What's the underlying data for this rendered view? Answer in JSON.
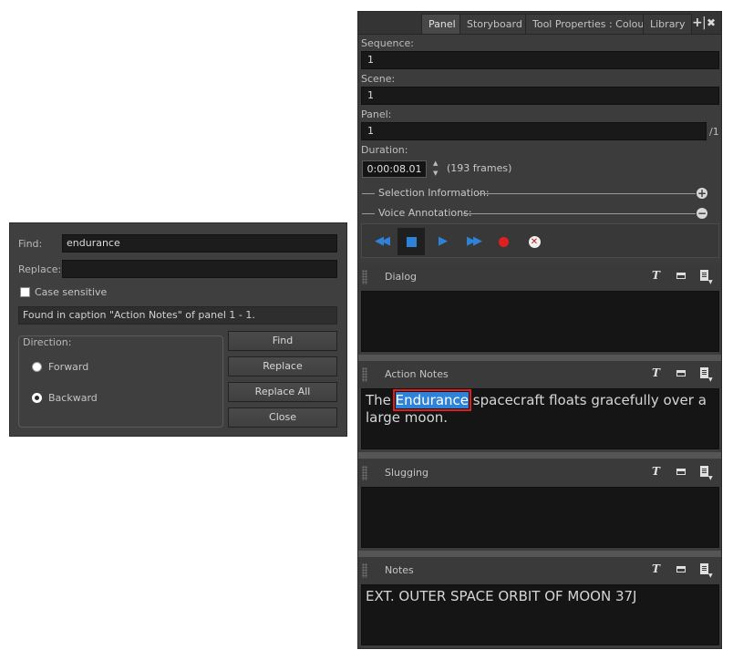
{
  "find_dialog": {
    "find_label": "Find:",
    "find_value": "endurance",
    "replace_label": "Replace:",
    "replace_value": "",
    "case_sensitive_label": "Case sensitive",
    "case_sensitive_checked": false,
    "status": "Found in caption \"Action Notes\" of panel 1 - 1.",
    "direction_label": "Direction:",
    "forward_label": "Forward",
    "backward_label": "Backward",
    "selected_direction": "Backward",
    "buttons": {
      "find": "Find",
      "replace": "Replace",
      "replace_all": "Replace All",
      "close": "Close"
    }
  },
  "panel_view": {
    "tabs": [
      "Panel",
      "Storyboard",
      "Tool Properties : Colour",
      "Library"
    ],
    "active_tab": "Panel",
    "tab_controls": {
      "add": "+",
      "pin": "|",
      "close": "✖"
    },
    "sequence_label": "Sequence:",
    "sequence_value": "1",
    "scene_label": "Scene:",
    "scene_value": "1",
    "panel_label": "Panel:",
    "panel_value": "1",
    "panel_total": "/1",
    "duration_label": "Duration:",
    "duration_value": "0:00:08.01",
    "frames_text": "(193 frames)",
    "selection_info_label": "Selection Information:",
    "voice_annotations_label": "Voice Annotations:",
    "audio_buttons": [
      "rewind-icon",
      "stop-icon",
      "play-icon",
      "fast-forward-icon",
      "record-icon",
      "delete-recording-icon"
    ],
    "colors": {
      "accent_blue": "#2e82d8",
      "record_red": "#e02020",
      "highlight_outline": "#e21b1b"
    },
    "captions": {
      "dialog": {
        "title": "Dialog",
        "text": ""
      },
      "action_notes": {
        "title": "Action Notes",
        "text_before": "The ",
        "text_match": "Endurance",
        "text_after": " spacecraft floats gracefully over a large moon."
      },
      "slugging": {
        "title": "Slugging",
        "text": ""
      },
      "notes": {
        "title": "Notes",
        "text": "EXT. OUTER SPACE ORBIT OF MOON 37J"
      }
    }
  }
}
